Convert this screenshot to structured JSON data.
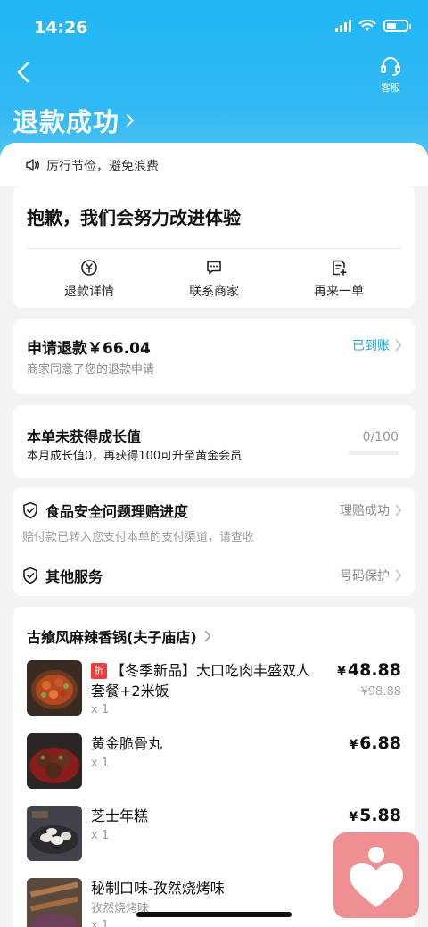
{
  "status_bar": {
    "time": "14:26"
  },
  "header": {
    "title": "退款成功",
    "service_label": "客服"
  },
  "notice": {
    "text": "厉行节俭，避免浪费"
  },
  "apology_card": {
    "title": "抱歉，我们会努力改进体验",
    "actions": [
      {
        "label": "退款详情",
        "icon": "yen-circle-icon"
      },
      {
        "label": "联系商家",
        "icon": "chat-bubble-icon"
      },
      {
        "label": "再来一单",
        "icon": "reorder-icon"
      }
    ]
  },
  "refund_card": {
    "title": "申请退款￥66.04",
    "subtitle": "商家同意了您的退款申请",
    "status": "已到账"
  },
  "growth_card": {
    "title": "本单未获得成长值",
    "subtitle": "本月成长值0，再获得100可升至黄金会员",
    "progress_text": "0/100",
    "progress_value": 0,
    "progress_max": 100
  },
  "service_card": {
    "food_safety": {
      "title": "食品安全问题理赔进度",
      "status": "理赔成功",
      "note": "赔付款已转入您支付本单的支付渠道，请查收"
    },
    "other": {
      "title": "其他服务",
      "status": "号码保护"
    }
  },
  "order": {
    "shop_name": "古飨风麻辣香锅(夫子庙店)",
    "items": [
      {
        "badge": "折",
        "name": "【冬季新品】大口吃肉丰盛双人套餐+2米饭",
        "qty": "x 1",
        "price_symbol": "¥",
        "price": "48.88",
        "original_price": "¥98.88"
      },
      {
        "name": "黄金脆骨丸",
        "qty": "x 1",
        "price_symbol": "¥",
        "price": "6.88"
      },
      {
        "name": "芝士年糕",
        "qty": "x 1",
        "price_symbol": "¥",
        "price": "5.88"
      },
      {
        "name": "秘制口味-孜然烧烤味",
        "spec": "孜然烧烤味",
        "qty": "x 1"
      }
    ]
  },
  "colors": {
    "header_blue": "#21b6f6",
    "accent_blue": "#1aa3ec",
    "discount_red": "#f23b3b",
    "float_button_pink": "#f08f91"
  }
}
